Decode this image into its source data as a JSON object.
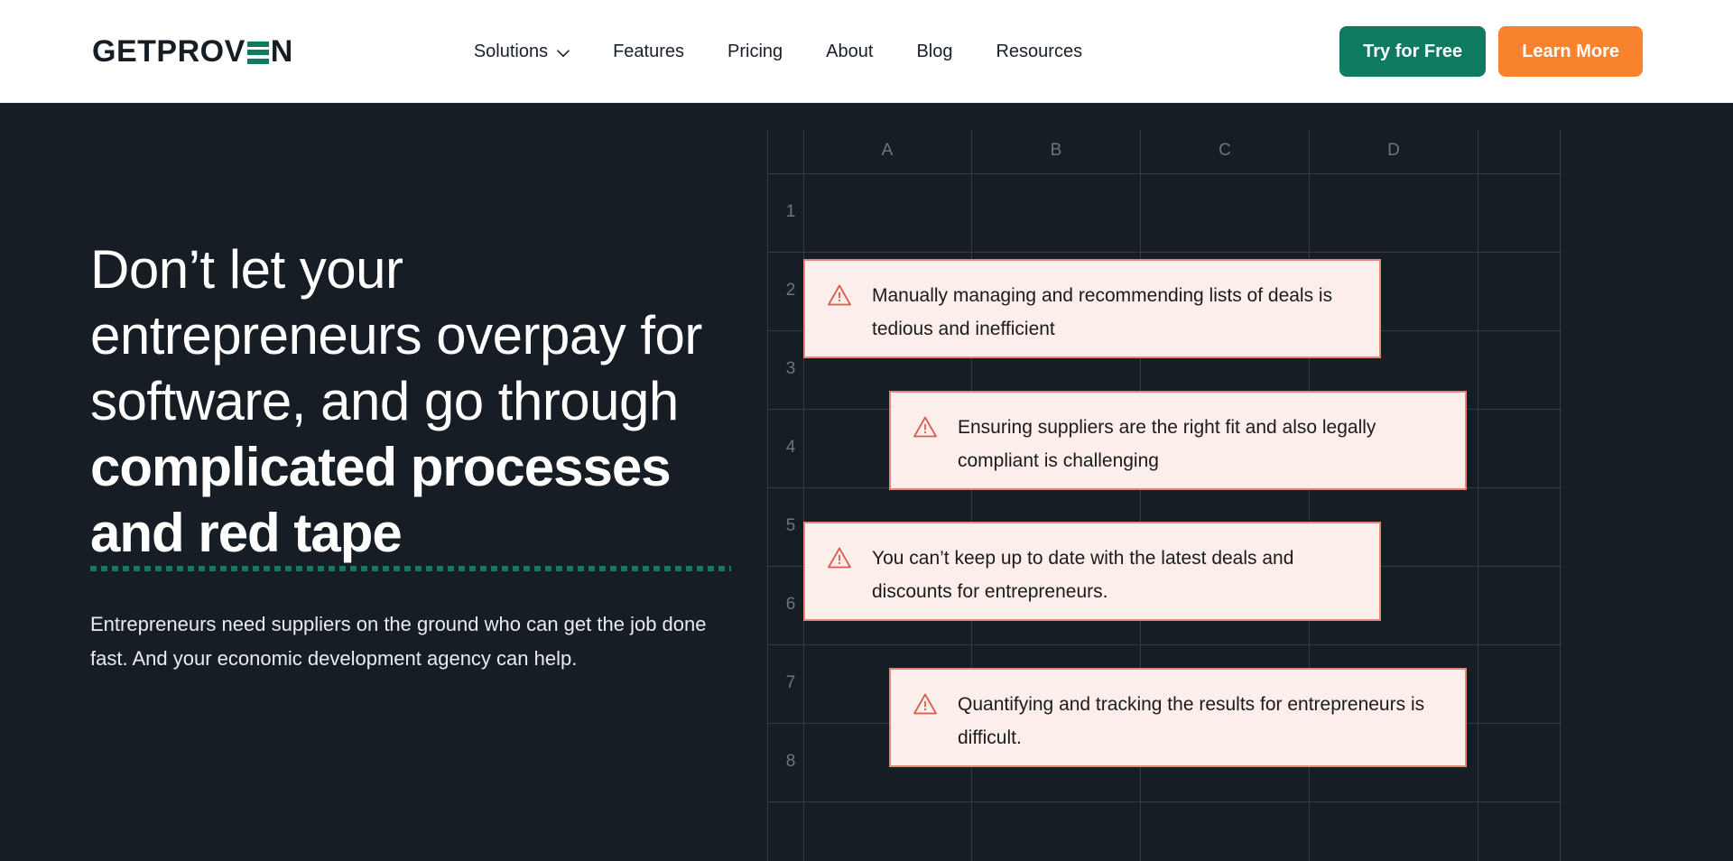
{
  "header": {
    "logo": {
      "text_before": "GETPROV",
      "icon": "logo-e-bars",
      "text_after": "N",
      "full": "GETPROVEN"
    },
    "nav": [
      {
        "label": "Solutions",
        "has_dropdown": true,
        "icon": "chevron-down-icon"
      },
      {
        "label": "Features",
        "has_dropdown": false
      },
      {
        "label": "Pricing",
        "has_dropdown": false
      },
      {
        "label": "About",
        "has_dropdown": false
      },
      {
        "label": "Blog",
        "has_dropdown": false
      },
      {
        "label": "Resources",
        "has_dropdown": false
      }
    ],
    "cta_primary": "Try for Free",
    "cta_secondary": "Learn More",
    "colors": {
      "primary": "#0E7A5F",
      "secondary": "#F8822E",
      "text": "#18202B",
      "bg": "#FFFFFF"
    }
  },
  "hero": {
    "headline_part1": "Don’t let your entrepreneurs overpay for software, and go through ",
    "headline_emphasis": "complicated processes and red tape",
    "subhead": "Entrepreneurs need suppliers on the ground who can get the job done fast. And your economic development agency can help.",
    "bg_color": "#161D24",
    "underline_color": "#19775F"
  },
  "spreadsheet": {
    "column_headers": [
      "A",
      "B",
      "C",
      "D"
    ],
    "row_headers": [
      "1",
      "2",
      "3",
      "4",
      "5",
      "6",
      "7",
      "8"
    ],
    "grid_line_color": "#333C44",
    "header_text_color": "#6E757C",
    "callout_bg": "#FBEEEB",
    "callout_border": "#E8837A",
    "callouts": [
      {
        "icon": "warning-triangle-icon",
        "text": "Manually managing and recommending lists of deals is tedious and inefficient"
      },
      {
        "icon": "warning-triangle-icon",
        "text": "Ensuring suppliers are the right fit and also legally compliant is challenging"
      },
      {
        "icon": "warning-triangle-icon",
        "text": "You can’t keep up to date with the latest deals and discounts for entrepreneurs."
      },
      {
        "icon": "warning-triangle-icon",
        "text": "Quantifying and tracking the results for entrepreneurs is difficult."
      }
    ]
  }
}
